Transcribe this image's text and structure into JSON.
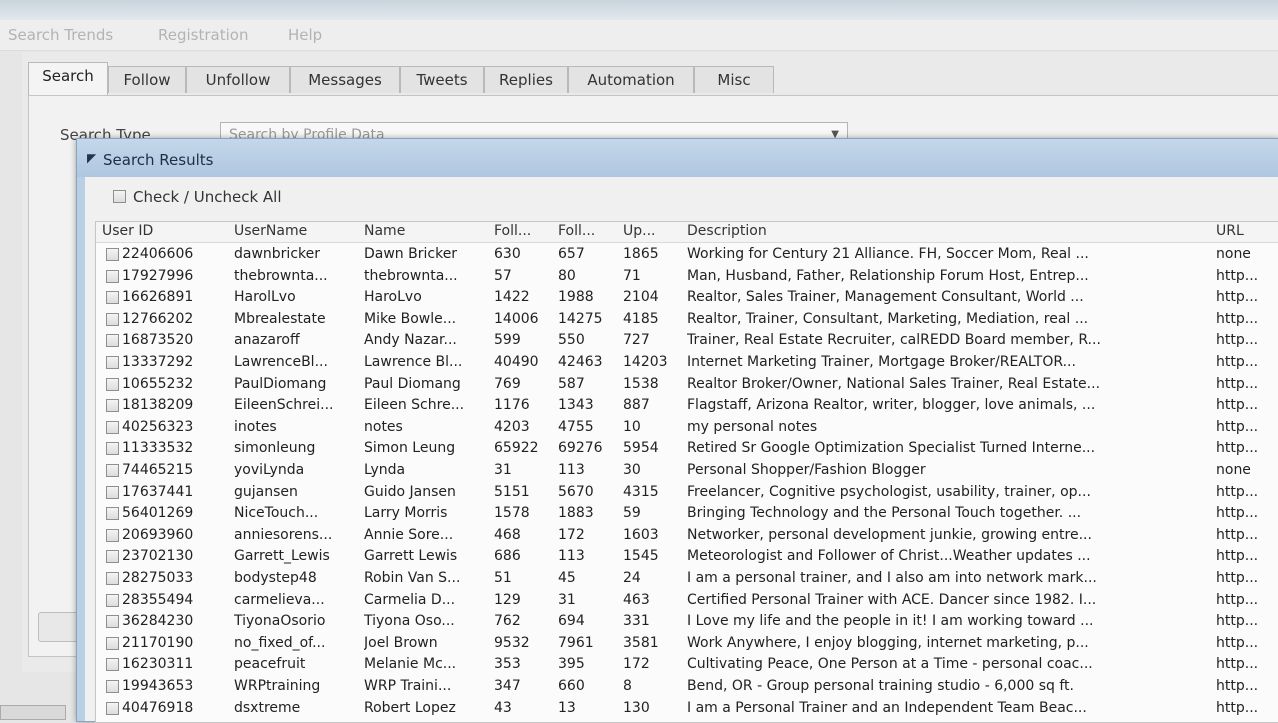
{
  "menu": [
    "Search Trends",
    "Registration",
    "Help"
  ],
  "tabs": [
    "Search",
    "Follow",
    "Unfollow",
    "Messages",
    "Tweets",
    "Replies",
    "Automation",
    "Misc"
  ],
  "search_type": {
    "label": "Search Type",
    "value": "Search by Profile Data"
  },
  "dialog": {
    "title": "Search Results",
    "check_all_label": "Check / Uncheck All",
    "columns": [
      "User ID",
      "UserName",
      "Name",
      "Foll...",
      "Foll...",
      "Up...",
      "Description",
      "URL"
    ],
    "rows": [
      [
        "22406606",
        "dawnbricker",
        "Dawn Bricker",
        "630",
        "657",
        "1865",
        "Working for Century 21 Alliance. FH, Soccer Mom, Real ...",
        "none"
      ],
      [
        "17927996",
        "thebrownta...",
        "thebrownta...",
        "57",
        "80",
        "71",
        "Man, Husband, Father, Relationship Forum Host, Entrep...",
        "http..."
      ],
      [
        "16626891",
        "HarolLvo",
        "HaroLvo",
        "1422",
        "1988",
        "2104",
        "Realtor, Sales Trainer, Management Consultant, World ...",
        "http..."
      ],
      [
        "12766202",
        "Mbrealestate",
        "Mike Bowle...",
        "14006",
        "14275",
        "4185",
        "Realtor, Trainer, Consultant, Marketing, Mediation, real ...",
        "http..."
      ],
      [
        "16873520",
        "anazaroff",
        "Andy Nazar...",
        "599",
        "550",
        "727",
        "Trainer, Real Estate Recruiter, calREDD Board member, R...",
        "http..."
      ],
      [
        "13337292",
        "LawrenceBl...",
        "Lawrence Bl...",
        "40490",
        "42463",
        "14203",
        "Internet Marketing Trainer, Mortgage Broker/REALTOR...",
        "http..."
      ],
      [
        "10655232",
        "PaulDiomang",
        "Paul Diomang",
        "769",
        "587",
        "1538",
        "Realtor Broker/Owner, National Sales Trainer, Real Estate...",
        "http..."
      ],
      [
        "18138209",
        "EileenSchrei...",
        "Eileen Schre...",
        "1176",
        "1343",
        "887",
        "Flagstaff, Arizona Realtor, writer, blogger, love animals, ...",
        "http..."
      ],
      [
        "40256323",
        "inotes",
        "notes",
        "4203",
        "4755",
        "10",
        "my personal notes",
        "http..."
      ],
      [
        "11333532",
        "simonleung",
        "Simon Leung",
        "65922",
        "69276",
        "5954",
        "Retired Sr Google Optimization Specialist Turned Interne...",
        "http..."
      ],
      [
        "74465215",
        "yoviLynda",
        "Lynda",
        "31",
        "113",
        "30",
        "Personal Shopper/Fashion Blogger",
        "none"
      ],
      [
        "17637441",
        "gujansen",
        "Guido Jansen",
        "5151",
        "5670",
        "4315",
        "Freelancer, Cognitive psychologist, usability, trainer, op...",
        "http..."
      ],
      [
        "56401269",
        "NiceTouch...",
        "Larry Morris",
        "1578",
        "1883",
        "59",
        "Bringing Technology and the Personal Touch together. ...",
        "http..."
      ],
      [
        "20693960",
        "anniesorens...",
        "Annie Sore...",
        "468",
        "172",
        "1603",
        "Networker, personal development junkie, growing entre...",
        "http..."
      ],
      [
        "23702130",
        "Garrett_Lewis",
        "Garrett Lewis",
        "686",
        "113",
        "1545",
        "Meteorologist and Follower of Christ...Weather updates ...",
        "http..."
      ],
      [
        "28275033",
        "bodystep48",
        "Robin Van S...",
        "51",
        "45",
        "24",
        "I am a personal trainer, and I also am into network mark...",
        "http..."
      ],
      [
        "28355494",
        "carmelieva...",
        "Carmelia D...",
        "129",
        "31",
        "463",
        "Certified Personal Trainer with ACE. Dancer since 1982. I...",
        "http..."
      ],
      [
        "36284230",
        "TiyonaOsorio",
        "Tiyona Oso...",
        "762",
        "694",
        "331",
        "I Love my life and the people in it! I am working toward ...",
        "http..."
      ],
      [
        "21170190",
        "no_fixed_of...",
        "Joel Brown",
        "9532",
        "7961",
        "3581",
        "Work Anywhere, I enjoy blogging, internet marketing, p...",
        "http..."
      ],
      [
        "16230311",
        "peacefruit",
        "Melanie Mc...",
        "353",
        "395",
        "172",
        "Cultivating Peace, One Person at a Time - personal coac...",
        "http..."
      ],
      [
        "19943653",
        "WRPtraining",
        "WRP Traini...",
        "347",
        "660",
        "8",
        "Bend, OR - Group personal training studio - 6,000 sq ft.",
        "http..."
      ],
      [
        "40476918",
        "dsxtreme",
        "Robert Lopez",
        "43",
        "13",
        "130",
        "I am a Personal Trainer and an Independent Team Beac...",
        "http..."
      ]
    ]
  }
}
